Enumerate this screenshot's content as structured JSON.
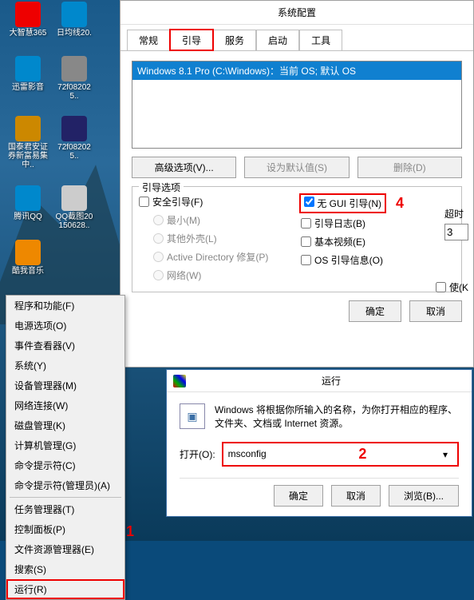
{
  "desktop_icons": [
    {
      "label": "大智慧365",
      "color": "#e00"
    },
    {
      "label": "日均线20.",
      "color": "#08c"
    },
    {
      "label": "迅雷影音",
      "color": "#08c"
    },
    {
      "label": "72f082025..",
      "color": "#888"
    },
    {
      "label": "国泰君安证券新富易集中..",
      "color": "#c80"
    },
    {
      "label": "72f082025..",
      "color": "#226"
    },
    {
      "label": "腾讯QQ",
      "color": "#08c"
    },
    {
      "label": "QQ截图20150628..",
      "color": "#ccc"
    },
    {
      "label": "酷我音乐",
      "color": "#e80"
    }
  ],
  "context_menu": {
    "items": [
      "程序和功能(F)",
      "电源选项(O)",
      "事件查看器(V)",
      "系统(Y)",
      "设备管理器(M)",
      "网络连接(W)",
      "磁盘管理(K)",
      "计算机管理(G)",
      "命令提示符(C)",
      "命令提示符(管理员)(A)",
      "---",
      "任务管理器(T)",
      "控制面板(P)",
      "文件资源管理器(E)",
      "搜索(S)",
      "运行(R)"
    ],
    "highlighted_index": 15
  },
  "syscfg": {
    "title": "系统配置",
    "tabs": [
      "常规",
      "引导",
      "服务",
      "启动",
      "工具"
    ],
    "active_tab": 1,
    "boot_entry": "Windows 8.1 Pro (C:\\Windows)：当前 OS; 默认 OS",
    "buttons": {
      "adv": "高级选项(V)...",
      "default": "设为默认值(S)",
      "delete": "删除(D)"
    },
    "group_title": "引导选项",
    "safe_boot": "安全引导(F)",
    "safe_min": "最小(M)",
    "safe_alt": "其他外壳(L)",
    "safe_ad": "Active Directory 修复(P)",
    "safe_net": "网络(W)",
    "no_gui": "无 GUI 引导(N)",
    "boot_log": "引导日志(B)",
    "base_video": "基本视频(E)",
    "os_info": "OS 引导信息(O)",
    "timeout_label": "超时",
    "timeout_value": "3",
    "perm_label": "使(K",
    "ok": "确定",
    "cancel": "取消"
  },
  "run": {
    "title": "运行",
    "desc": "Windows 将根据你所输入的名称，为你打开相应的程序、文件夹、文档或 Internet 资源。",
    "open_label": "打开(O):",
    "value": "msconfig",
    "ok": "确定",
    "cancel": "取消",
    "browse": "浏览(B)..."
  },
  "annotations": {
    "tab": "",
    "run_num": "2",
    "no_gui_num": "4",
    "run_menu_num": "1"
  }
}
